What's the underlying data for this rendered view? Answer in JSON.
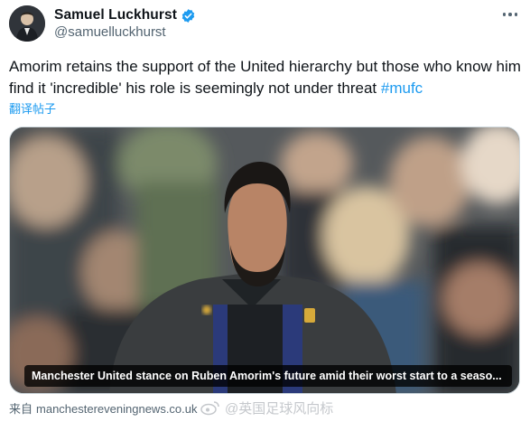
{
  "author": {
    "display_name": "Samuel Luckhurst",
    "handle": "@samuelluckhurst",
    "verified": true,
    "verified_color": "#1d9bf0"
  },
  "tweet": {
    "text": "Amorim retains the support of the United hierarchy but those who know him find it 'incredible' his role is seemingly not under threat ",
    "hashtag": "#mufc",
    "translate_label": "翻译帖子"
  },
  "media": {
    "caption": "Manchester United stance on Ruben Amorim's future amid their worst start to a seaso...",
    "source_prefix": "来自",
    "source_domain": "manchestereveningnews.co.uk"
  },
  "watermark": {
    "text": "@英国足球风向标",
    "icon": "weibo-icon"
  },
  "icons": {
    "more": "more-icon",
    "verified": "verified-badge-icon"
  },
  "colors": {
    "text": "#0f1419",
    "secondary": "#536471",
    "link": "#1d9bf0"
  }
}
